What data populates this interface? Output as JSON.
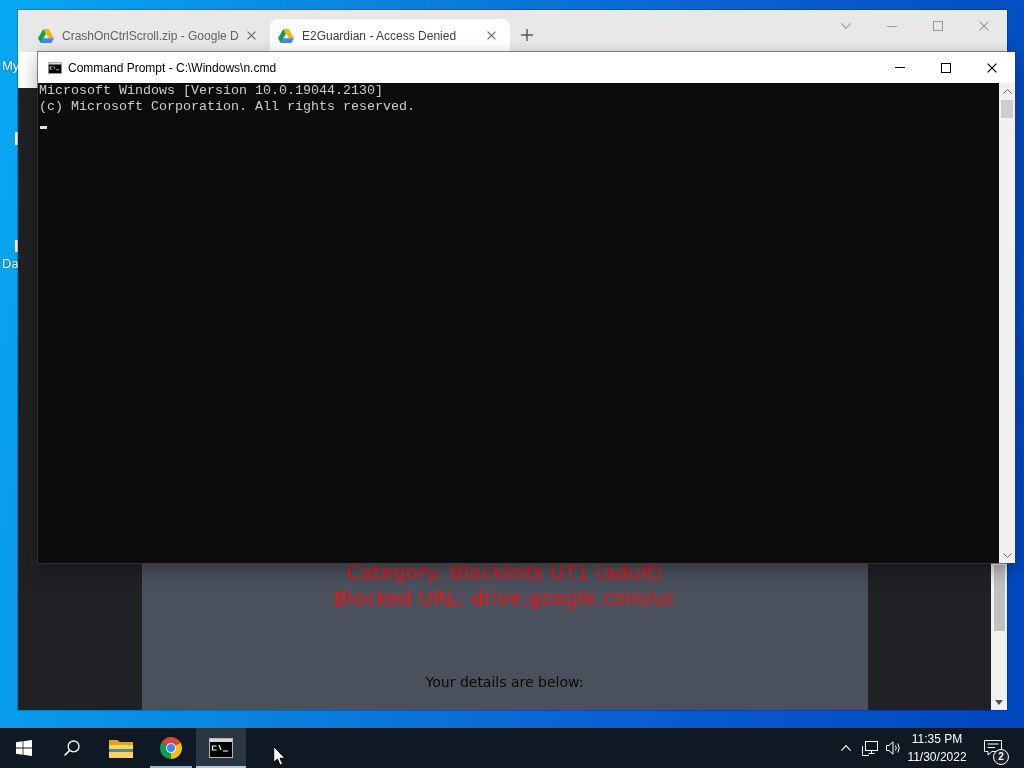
{
  "desktop": {
    "icons": [
      {
        "label": "My"
      },
      {
        "label": "Da"
      }
    ]
  },
  "browser": {
    "tabs": [
      {
        "title": "CrashOnCtrlScroll.zip - Google D",
        "selected": false
      },
      {
        "title": "E2Guardian - Access Denied",
        "selected": true
      }
    ],
    "page": {
      "lines": [
        {
          "kind": "alert",
          "text": "Category: Blacklists UT1 (adult)"
        },
        {
          "kind": "alert",
          "text": "Blocked URL: drive.google.com/uc"
        },
        {
          "kind": "note",
          "text": "Your details are below:"
        }
      ]
    }
  },
  "console": {
    "title": "Command Prompt - C:\\Windows\\n.cmd",
    "lines": [
      "Microsoft Windows [Version 10.0.19044.2130]",
      "(c) Microsoft Corporation. All rights reserved."
    ]
  },
  "taskbar": {
    "apps": [
      {
        "kind": "folder",
        "running": false,
        "selected": false
      },
      {
        "kind": "browser",
        "running": true,
        "selected": false
      },
      {
        "kind": "console",
        "running": true,
        "selected": true
      }
    ],
    "clock": {
      "time": "11:35 PM",
      "date": "11/30/2022"
    },
    "notifications": {
      "count": "2"
    }
  }
}
